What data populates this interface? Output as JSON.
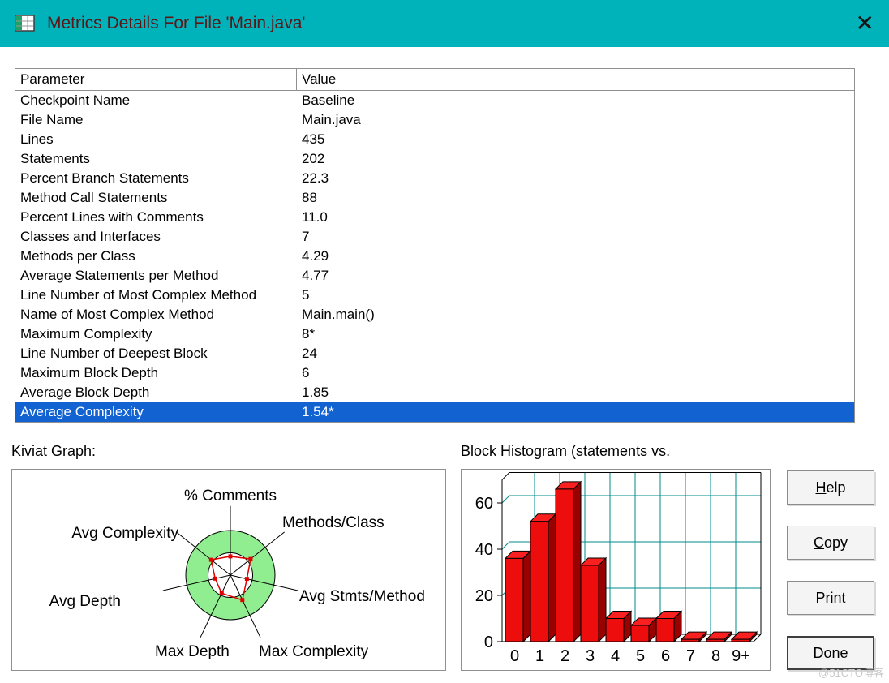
{
  "window": {
    "title": "Metrics Details For File 'Main.java'",
    "close_glyph": "✕"
  },
  "colors": {
    "titlebar": "#00b3bb",
    "title_text": "#5c1616",
    "selection_bg": "#1262d2",
    "bar_red": "#ee0d0d",
    "grid_teal": "#008b8b",
    "kiviat_green": "#90ee90"
  },
  "table": {
    "headers": [
      "Parameter",
      "Value"
    ],
    "rows": [
      {
        "param": "Checkpoint Name",
        "value": "Baseline",
        "selected": false
      },
      {
        "param": "File Name",
        "value": "Main.java",
        "selected": false
      },
      {
        "param": "Lines",
        "value": "435",
        "selected": false
      },
      {
        "param": "Statements",
        "value": "202",
        "selected": false
      },
      {
        "param": "Percent Branch Statements",
        "value": "22.3",
        "selected": false
      },
      {
        "param": "Method Call Statements",
        "value": "88",
        "selected": false
      },
      {
        "param": "Percent Lines with Comments",
        "value": "11.0",
        "selected": false
      },
      {
        "param": "Classes and Interfaces",
        "value": "7",
        "selected": false
      },
      {
        "param": "Methods per Class",
        "value": "4.29",
        "selected": false
      },
      {
        "param": "Average Statements per Method",
        "value": "4.77",
        "selected": false
      },
      {
        "param": "Line Number of Most Complex Method",
        "value": "5",
        "selected": false
      },
      {
        "param": "Name of Most Complex Method",
        "value": "Main.main()",
        "selected": false
      },
      {
        "param": "Maximum Complexity",
        "value": "8*",
        "selected": false
      },
      {
        "param": "Line Number of Deepest Block",
        "value": "24",
        "selected": false
      },
      {
        "param": "Maximum Block Depth",
        "value": "6",
        "selected": false
      },
      {
        "param": "Average Block Depth",
        "value": "1.85",
        "selected": false
      },
      {
        "param": "Average Complexity",
        "value": "1.54*",
        "selected": true
      }
    ]
  },
  "kiviat": {
    "section_label": "Kiviat Graph:"
  },
  "histogram": {
    "section_label": "Block Histogram (statements vs."
  },
  "buttons": [
    {
      "label": "Help"
    },
    {
      "label": "Copy"
    },
    {
      "label": "Print"
    },
    {
      "label": "Done"
    }
  ],
  "watermark": "@51CTO博客",
  "chart_data": [
    {
      "type": "radar",
      "title": "Kiviat Graph",
      "axes": [
        "% Comments",
        "Methods/Class",
        "Avg Stmts/Method",
        "Max Complexity",
        "Max Depth",
        "Avg Depth",
        "Avg Complexity"
      ],
      "values_norm": [
        0.42,
        0.58,
        0.38,
        0.62,
        0.45,
        0.35,
        0.55
      ],
      "ring_inner_norm": 0.5,
      "ring_outer_norm": 1.0,
      "ring_color": "#90ee90",
      "point_color": "#e00000"
    },
    {
      "type": "bar",
      "title": "Block Histogram (statements vs.",
      "categories": [
        "0",
        "1",
        "2",
        "3",
        "4",
        "5",
        "6",
        "7",
        "8",
        "9+"
      ],
      "values": [
        36,
        52,
        66,
        33,
        10,
        7,
        10,
        1,
        1,
        1
      ],
      "yticks": [
        0,
        20,
        40,
        60
      ],
      "ylim": [
        0,
        70
      ],
      "bar_color": "#ee0d0d",
      "bar_top": "#fb2020",
      "bar_side": "#990000",
      "grid_color": "#008b8b",
      "style_3d": true,
      "legend": "none",
      "grid": true
    }
  ]
}
